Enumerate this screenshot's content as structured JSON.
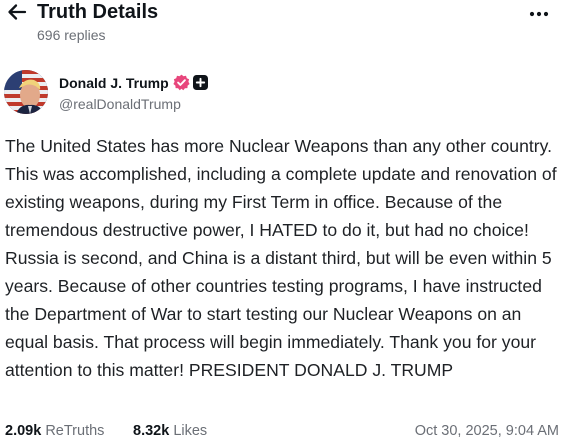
{
  "header": {
    "title": "Truth Details",
    "subtitle": "696 replies",
    "back_icon": "arrow-left-icon",
    "more_icon": "more-horizontal-icon"
  },
  "post": {
    "author": {
      "name": "Donald J. Trump",
      "handle": "@realDonaldTrump",
      "verified_icon": "verified-badge-icon",
      "follow_icon": "plus-box-icon"
    },
    "body": "The United States has more Nuclear Weapons than any other country. This was accomplished, including a complete update and renovation of existing weapons, during my First Term in office. Because of the tremendous destructive power, I HATED to do it, but had no choice! Russia is second, and China is a distant third, but will be even within 5 years. Because of other countries testing programs, I have instructed the Department of War to start testing our Nuclear Weapons on an equal basis. That process will begin immediately. Thank you for your attention to this matter! PRESIDENT DONALD J. TRUMP",
    "stats": {
      "retruths_count": "2.09k",
      "retruths_label": "ReTruths",
      "likes_count": "8.32k",
      "likes_label": "Likes"
    },
    "timestamp": "Oct 30, 2025, 9:04 AM"
  },
  "colors": {
    "text_primary": "#0f1419",
    "text_secondary": "#6b6f76",
    "verified_badge": "#e8467c",
    "background": "#ffffff"
  }
}
